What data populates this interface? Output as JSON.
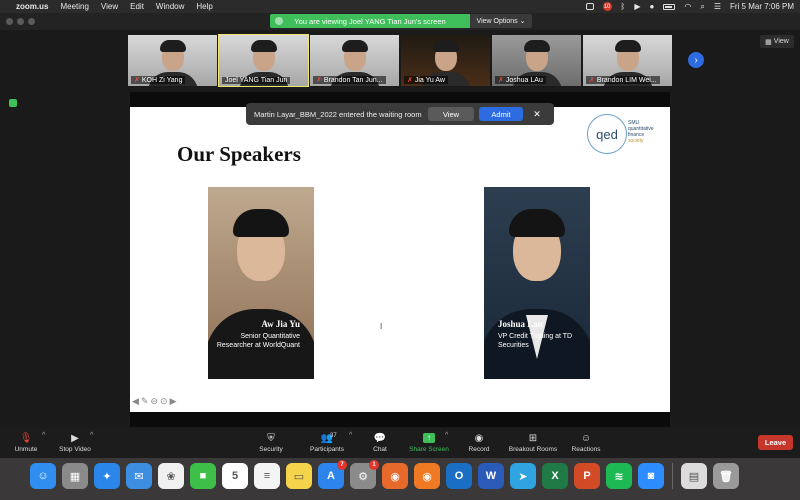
{
  "menubar": {
    "app": "zoom.us",
    "menus": [
      "Meeting",
      "View",
      "Edit",
      "Window",
      "Help"
    ],
    "notification_count": "10",
    "datetime": "Fri 5 Mar  7:06 PM"
  },
  "titlebar": {
    "share_banner": "You are viewing Joel YANG Tian Jun's screen",
    "view_options": "View Options ⌄"
  },
  "gallery": {
    "participants": [
      {
        "name": "KOH Zi Yang"
      },
      {
        "name": "Joel YANG Tian Jun"
      },
      {
        "name": "Brandon Tan Jun..."
      },
      {
        "name": "Jia Yu Aw"
      },
      {
        "name": "Joshua LAu"
      },
      {
        "name": "Brandon LIM Wei..."
      }
    ],
    "view_label": "View"
  },
  "waiting_room": {
    "message": "Martin Layar_BBM_2022 entered the waiting room",
    "view_label": "View",
    "admit_label": "Admit",
    "close_glyph": "✕"
  },
  "slide": {
    "title": "Our Speakers",
    "logo_text": "qed",
    "logo_lines": [
      "SMU",
      "quantitative",
      "finance",
      "society"
    ],
    "speakers": [
      {
        "name": "Aw Jia Yu",
        "role": "Senior Quantitative Researcher at WorldQuant"
      },
      {
        "name": "Joshua Lau",
        "role": "VP Credit Trading at TD Securities"
      }
    ]
  },
  "toolbar": {
    "unmute": "Unmute",
    "stop_video": "Stop Video",
    "security": "Security",
    "participants": "Participants",
    "participants_count": "37",
    "chat": "Chat",
    "share_screen": "Share Screen",
    "record": "Record",
    "breakout": "Breakout Rooms",
    "reactions": "Reactions",
    "leave": "Leave"
  },
  "dock": {
    "apps": [
      {
        "name": "Finder",
        "color": "#2f8ef0",
        "glyph": "☺"
      },
      {
        "name": "Launchpad",
        "color": "#8a8a8a",
        "glyph": "▦"
      },
      {
        "name": "Safari",
        "color": "#2a86e8",
        "glyph": "✦"
      },
      {
        "name": "Mail",
        "color": "#3d8de0",
        "glyph": "✉"
      },
      {
        "name": "Photos",
        "color": "#f0f0f0",
        "glyph": "❀"
      },
      {
        "name": "FaceTime",
        "color": "#3dbf4a",
        "glyph": "■"
      },
      {
        "name": "Calendar",
        "color": "#ffffff",
        "glyph": "5"
      },
      {
        "name": "Reminders",
        "color": "#f4f4f4",
        "glyph": "≡"
      },
      {
        "name": "Notes",
        "color": "#f5d34a",
        "glyph": "▭"
      },
      {
        "name": "App Store",
        "color": "#2d84ec",
        "glyph": "A",
        "badge": "7"
      },
      {
        "name": "System Preferences",
        "color": "#8b8b8b",
        "glyph": "⚙",
        "badge": "1"
      },
      {
        "name": "Firefox Dev",
        "color": "#e86a2a",
        "glyph": "◉"
      },
      {
        "name": "Firefox",
        "color": "#f07a24",
        "glyph": "◉"
      },
      {
        "name": "Outlook",
        "color": "#1a6fc4",
        "glyph": "O"
      },
      {
        "name": "Word",
        "color": "#2a5bb8",
        "glyph": "W"
      },
      {
        "name": "Telegram",
        "color": "#2fa4e0",
        "glyph": "➤"
      },
      {
        "name": "Excel",
        "color": "#1f7a45",
        "glyph": "X"
      },
      {
        "name": "PowerPoint",
        "color": "#d24a26",
        "glyph": "P"
      },
      {
        "name": "Spotify",
        "color": "#1db954",
        "glyph": "≋"
      },
      {
        "name": "Zoom",
        "color": "#2d8cff",
        "glyph": "◙"
      },
      {
        "name": "Preview",
        "color": "#dcdcdc",
        "glyph": "▤"
      },
      {
        "name": "Trash",
        "color": "#9a9a9a",
        "glyph": "🗑"
      }
    ]
  }
}
